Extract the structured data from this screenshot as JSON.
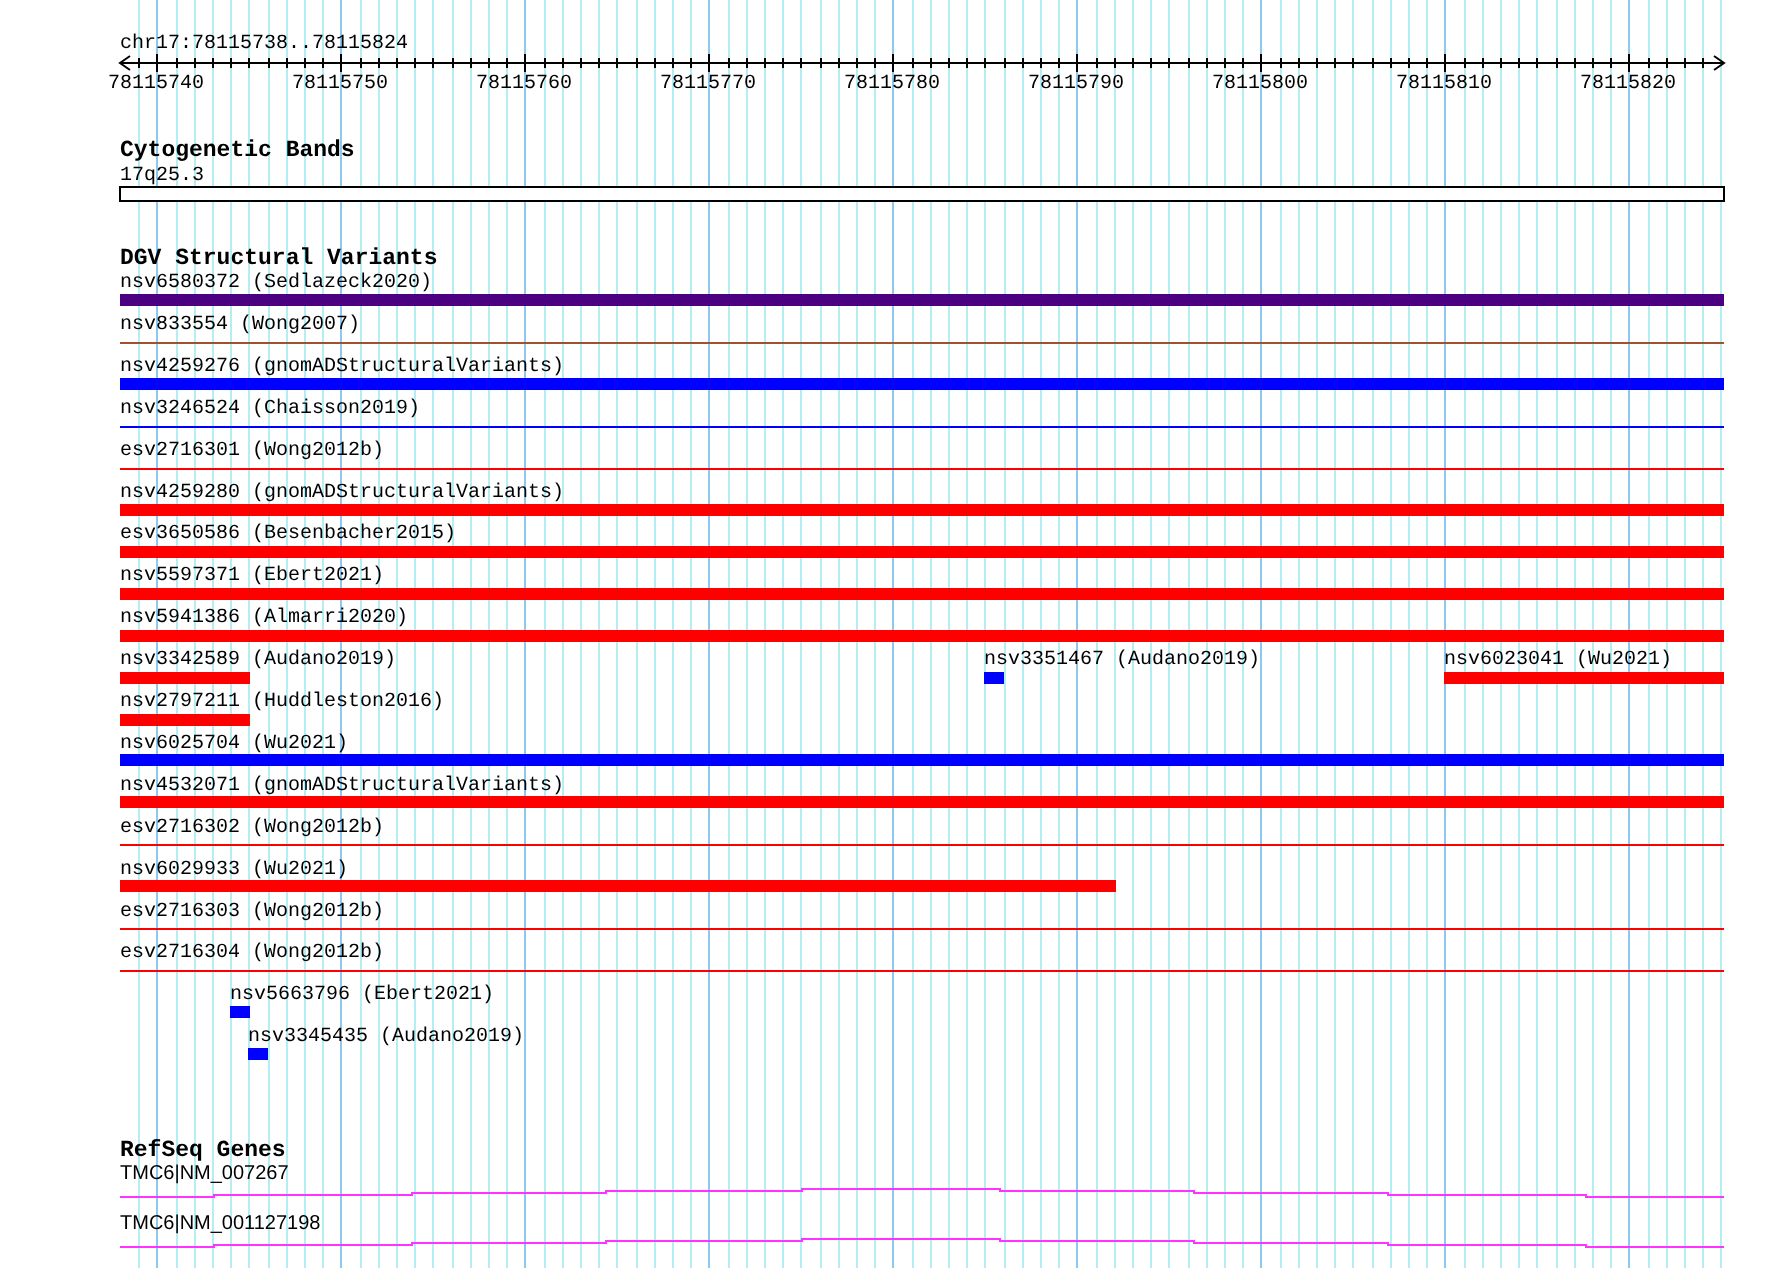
{
  "ruler": {
    "location": "chr17:78115738..78115824",
    "tick_labels": [
      "78115740",
      "78115750",
      "78115760",
      "78115770",
      "78115780",
      "78115790",
      "78115800",
      "78115810",
      "78115820"
    ]
  },
  "cytogenetic_bands": {
    "title": "Cytogenetic Bands",
    "bands": [
      {
        "label": "17q25.3"
      }
    ]
  },
  "dgv_structural_variants": {
    "title": "DGV Structural Variants",
    "rows": [
      [
        {
          "label": "nsv6580372 (Sedlazeck2020)",
          "color": "#4b0082",
          "kind": "thick"
        }
      ],
      [
        {
          "label": "nsv833554 (Wong2007)",
          "color": "#a0522d",
          "kind": "thin"
        }
      ],
      [
        {
          "label": "nsv4259276 (gnomADStructuralVariants)",
          "color": "#0000ff",
          "kind": "thick"
        }
      ],
      [
        {
          "label": "nsv3246524 (Chaisson2019)",
          "color": "#0000ff",
          "kind": "thin"
        }
      ],
      [
        {
          "label": "esv2716301 (Wong2012b)",
          "color": "#ff0000",
          "kind": "thin"
        }
      ],
      [
        {
          "label": "nsv4259280 (gnomADStructuralVariants)",
          "color": "#ff0000",
          "kind": "thick"
        }
      ],
      [
        {
          "label": "esv3650586 (Besenbacher2015)",
          "color": "#ff0000",
          "kind": "thick"
        }
      ],
      [
        {
          "label": "nsv5597371 (Ebert2021)",
          "color": "#ff0000",
          "kind": "thick"
        }
      ],
      [
        {
          "label": "nsv5941386 (Almarri2020)",
          "color": "#ff0000",
          "kind": "thick"
        }
      ],
      [
        {
          "label": "nsv3342589 (Audano2019)",
          "color": "#ff0000",
          "kind": "thick"
        },
        {
          "label": "nsv3351467 (Audano2019)",
          "color": "#0000ff",
          "kind": "thick"
        },
        {
          "label": "nsv6023041 (Wu2021)",
          "color": "#ff0000",
          "kind": "thick"
        }
      ],
      [
        {
          "label": "nsv2797211 (Huddleston2016)",
          "color": "#ff0000",
          "kind": "thick"
        }
      ],
      [
        {
          "label": "nsv6025704 (Wu2021)",
          "color": "#0000ff",
          "kind": "thick"
        }
      ],
      [
        {
          "label": "nsv4532071 (gnomADStructuralVariants)",
          "color": "#ff0000",
          "kind": "thick"
        }
      ],
      [
        {
          "label": "esv2716302 (Wong2012b)",
          "color": "#ff0000",
          "kind": "thin"
        }
      ],
      [
        {
          "label": "nsv6029933 (Wu2021)",
          "color": "#ff0000",
          "kind": "thick"
        }
      ],
      [
        {
          "label": "esv2716303 (Wong2012b)",
          "color": "#ff0000",
          "kind": "thin"
        }
      ],
      [
        {
          "label": "esv2716304 (Wong2012b)",
          "color": "#ff0000",
          "kind": "thin"
        }
      ],
      [
        {
          "label": "nsv5663796 (Ebert2021)",
          "color": "#0000ff",
          "kind": "thick"
        }
      ],
      [
        {
          "label": "nsv3345435 (Audano2019)",
          "color": "#0000ff",
          "kind": "thick"
        }
      ]
    ]
  },
  "refseq_genes": {
    "title": "RefSeq Genes",
    "genes": [
      {
        "label": "TMC6|NM_007267"
      },
      {
        "label": "TMC6|NM_001127198"
      }
    ]
  }
}
